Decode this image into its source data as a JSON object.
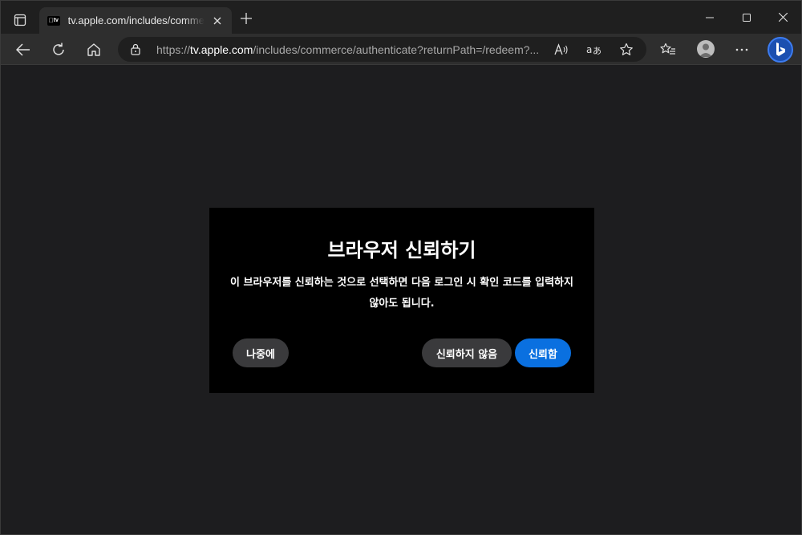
{
  "browser": {
    "tab": {
      "favicon_text": "tv",
      "title": "tv.apple.com/includes/commerce/authenticate?returnPath=/redeem"
    },
    "address": {
      "scheme": "https://",
      "host": "tv.apple.com",
      "path": "/includes/commerce/authenticate?returnPath=/redeem?..."
    }
  },
  "dialog": {
    "title": "브라우저 신뢰하기",
    "message": "이 브라우저를 신뢰하는 것으로 선택하면 다음 로그인 시 확인 코드를 입력하지 않아도 됩니다.",
    "buttons": {
      "later": "나중에",
      "dont_trust": "신뢰하지 않음",
      "trust": "신뢰함"
    }
  },
  "colors": {
    "accent": "#0a70e0",
    "dialog_bg": "#000000",
    "page_bg": "#1d1d1f"
  }
}
